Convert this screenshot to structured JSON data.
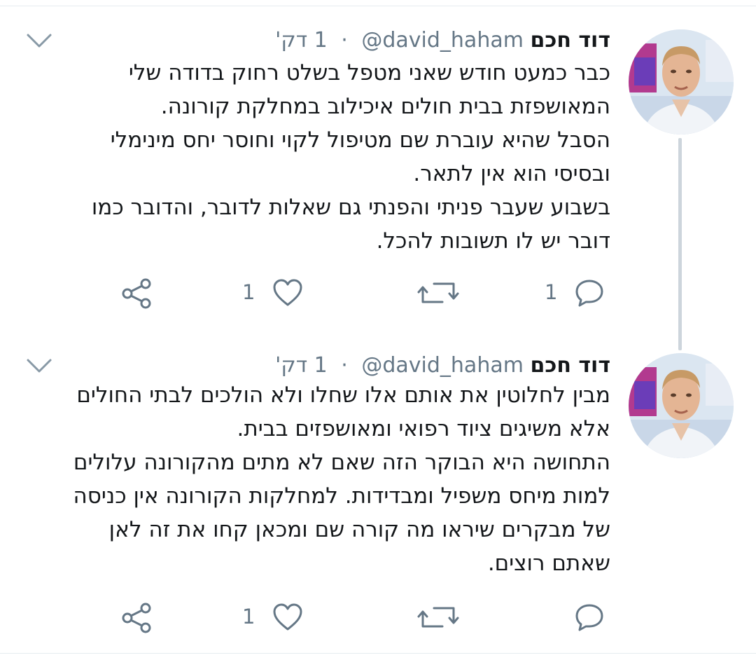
{
  "tweets": [
    {
      "name": "דוד חכם",
      "handle": "@david_haham",
      "separator": "·",
      "time": "1 דק'",
      "lines": [
        "כבר כמעט חודש שאני מטפל בשלט רחוק בדודה שלי",
        "המאושפזת בבית חולים איכילוב במחלקת קורונה.",
        "הסבל שהיא עוברת שם מטיפול לקוי וחוסר יחס מינימלי",
        "ובסיסי הוא אין לתאר.",
        "בשבוע שעבר פניתי והפנתי גם שאלות לדובר, והדובר כמו",
        "דובר יש לו תשובות להכל."
      ],
      "reply_count": "1",
      "retweet_count": "",
      "like_count": "1"
    },
    {
      "name": "דוד חכם",
      "handle": "@david_haham",
      "separator": "·",
      "time": "1 דק'",
      "lines": [
        "מבין לחלוטין את אותם אלו שחלו ולא הולכים לבתי החולים",
        "אלא משיגים ציוד רפואי ומאושפזים בבית.",
        "התחושה היא הבוקר הזה שאם לא מתים מהקורונה עלולים",
        "למות מיחס משפיל ומבדידות. למחלקות הקורונה אין כניסה",
        "של מבקרים שיראו מה קורה שם ומכאן קחו את זה לאן",
        "שאתם רוצים."
      ],
      "reply_count": "",
      "retweet_count": "",
      "like_count": "1"
    }
  ],
  "colors": {
    "text": "#14171a",
    "secondary": "#657786",
    "thread_line": "#cdd5dc",
    "divider": "#e6ecf0"
  },
  "icons": [
    "chevron-down-icon",
    "reply-icon",
    "retweet-icon",
    "like-icon",
    "share-icon"
  ]
}
